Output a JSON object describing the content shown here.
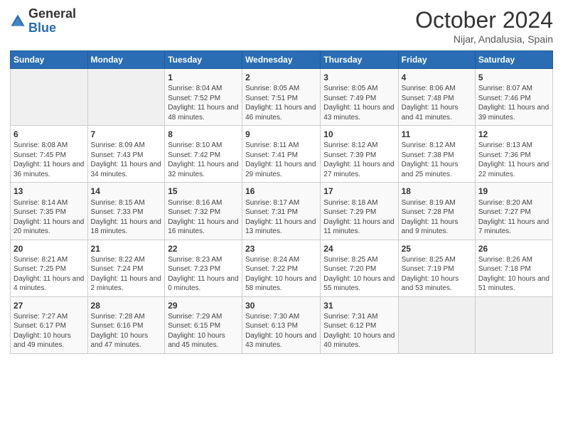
{
  "header": {
    "logo_general": "General",
    "logo_blue": "Blue",
    "month": "October 2024",
    "location": "Nijar, Andalusia, Spain"
  },
  "weekdays": [
    "Sunday",
    "Monday",
    "Tuesday",
    "Wednesday",
    "Thursday",
    "Friday",
    "Saturday"
  ],
  "weeks": [
    [
      {
        "day": "",
        "info": ""
      },
      {
        "day": "",
        "info": ""
      },
      {
        "day": "1",
        "info": "Sunrise: 8:04 AM\nSunset: 7:52 PM\nDaylight: 11 hours and 48 minutes."
      },
      {
        "day": "2",
        "info": "Sunrise: 8:05 AM\nSunset: 7:51 PM\nDaylight: 11 hours and 46 minutes."
      },
      {
        "day": "3",
        "info": "Sunrise: 8:05 AM\nSunset: 7:49 PM\nDaylight: 11 hours and 43 minutes."
      },
      {
        "day": "4",
        "info": "Sunrise: 8:06 AM\nSunset: 7:48 PM\nDaylight: 11 hours and 41 minutes."
      },
      {
        "day": "5",
        "info": "Sunrise: 8:07 AM\nSunset: 7:46 PM\nDaylight: 11 hours and 39 minutes."
      }
    ],
    [
      {
        "day": "6",
        "info": "Sunrise: 8:08 AM\nSunset: 7:45 PM\nDaylight: 11 hours and 36 minutes."
      },
      {
        "day": "7",
        "info": "Sunrise: 8:09 AM\nSunset: 7:43 PM\nDaylight: 11 hours and 34 minutes."
      },
      {
        "day": "8",
        "info": "Sunrise: 8:10 AM\nSunset: 7:42 PM\nDaylight: 11 hours and 32 minutes."
      },
      {
        "day": "9",
        "info": "Sunrise: 8:11 AM\nSunset: 7:41 PM\nDaylight: 11 hours and 29 minutes."
      },
      {
        "day": "10",
        "info": "Sunrise: 8:12 AM\nSunset: 7:39 PM\nDaylight: 11 hours and 27 minutes."
      },
      {
        "day": "11",
        "info": "Sunrise: 8:12 AM\nSunset: 7:38 PM\nDaylight: 11 hours and 25 minutes."
      },
      {
        "day": "12",
        "info": "Sunrise: 8:13 AM\nSunset: 7:36 PM\nDaylight: 11 hours and 22 minutes."
      }
    ],
    [
      {
        "day": "13",
        "info": "Sunrise: 8:14 AM\nSunset: 7:35 PM\nDaylight: 11 hours and 20 minutes."
      },
      {
        "day": "14",
        "info": "Sunrise: 8:15 AM\nSunset: 7:33 PM\nDaylight: 11 hours and 18 minutes."
      },
      {
        "day": "15",
        "info": "Sunrise: 8:16 AM\nSunset: 7:32 PM\nDaylight: 11 hours and 16 minutes."
      },
      {
        "day": "16",
        "info": "Sunrise: 8:17 AM\nSunset: 7:31 PM\nDaylight: 11 hours and 13 minutes."
      },
      {
        "day": "17",
        "info": "Sunrise: 8:18 AM\nSunset: 7:29 PM\nDaylight: 11 hours and 11 minutes."
      },
      {
        "day": "18",
        "info": "Sunrise: 8:19 AM\nSunset: 7:28 PM\nDaylight: 11 hours and 9 minutes."
      },
      {
        "day": "19",
        "info": "Sunrise: 8:20 AM\nSunset: 7:27 PM\nDaylight: 11 hours and 7 minutes."
      }
    ],
    [
      {
        "day": "20",
        "info": "Sunrise: 8:21 AM\nSunset: 7:25 PM\nDaylight: 11 hours and 4 minutes."
      },
      {
        "day": "21",
        "info": "Sunrise: 8:22 AM\nSunset: 7:24 PM\nDaylight: 11 hours and 2 minutes."
      },
      {
        "day": "22",
        "info": "Sunrise: 8:23 AM\nSunset: 7:23 PM\nDaylight: 11 hours and 0 minutes."
      },
      {
        "day": "23",
        "info": "Sunrise: 8:24 AM\nSunset: 7:22 PM\nDaylight: 10 hours and 58 minutes."
      },
      {
        "day": "24",
        "info": "Sunrise: 8:25 AM\nSunset: 7:20 PM\nDaylight: 10 hours and 55 minutes."
      },
      {
        "day": "25",
        "info": "Sunrise: 8:25 AM\nSunset: 7:19 PM\nDaylight: 10 hours and 53 minutes."
      },
      {
        "day": "26",
        "info": "Sunrise: 8:26 AM\nSunset: 7:18 PM\nDaylight: 10 hours and 51 minutes."
      }
    ],
    [
      {
        "day": "27",
        "info": "Sunrise: 7:27 AM\nSunset: 6:17 PM\nDaylight: 10 hours and 49 minutes."
      },
      {
        "day": "28",
        "info": "Sunrise: 7:28 AM\nSunset: 6:16 PM\nDaylight: 10 hours and 47 minutes."
      },
      {
        "day": "29",
        "info": "Sunrise: 7:29 AM\nSunset: 6:15 PM\nDaylight: 10 hours and 45 minutes."
      },
      {
        "day": "30",
        "info": "Sunrise: 7:30 AM\nSunset: 6:13 PM\nDaylight: 10 hours and 43 minutes."
      },
      {
        "day": "31",
        "info": "Sunrise: 7:31 AM\nSunset: 6:12 PM\nDaylight: 10 hours and 40 minutes."
      },
      {
        "day": "",
        "info": ""
      },
      {
        "day": "",
        "info": ""
      }
    ]
  ]
}
